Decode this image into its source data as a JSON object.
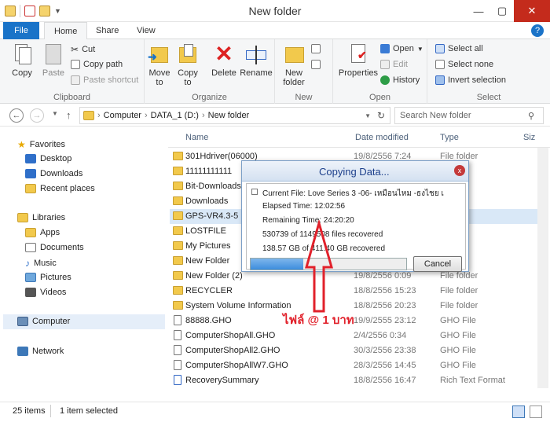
{
  "window": {
    "title": "New folder",
    "minimize": "—",
    "maximize": "▢",
    "close": "✕"
  },
  "tabs": {
    "file": "File",
    "home": "Home",
    "share": "Share",
    "view": "View",
    "help": "?"
  },
  "ribbon": {
    "clipboard": {
      "label": "Clipboard",
      "copy": "Copy",
      "paste": "Paste",
      "cut": "Cut",
      "copy_path": "Copy path",
      "paste_shortcut": "Paste shortcut"
    },
    "organize": {
      "label": "Organize",
      "move_to": "Move to",
      "copy_to": "Copy to",
      "delete": "Delete",
      "rename": "Rename"
    },
    "new": {
      "label": "New",
      "new_folder": "New folder"
    },
    "open": {
      "label": "Open",
      "properties": "Properties",
      "open": "Open",
      "edit": "Edit",
      "history": "History"
    },
    "select": {
      "label": "Select",
      "select_all": "Select all",
      "select_none": "Select none",
      "invert_selection": "Invert selection"
    }
  },
  "address": {
    "back": "←",
    "forward": "→",
    "up": "↑",
    "crumbs": [
      "Computer",
      "DATA_1 (D:)",
      "New folder"
    ],
    "refresh": "↻",
    "search_placeholder": "Search New folder"
  },
  "nav": {
    "favorites": "Favorites",
    "fav_items": [
      "Desktop",
      "Downloads",
      "Recent places"
    ],
    "libraries": "Libraries",
    "lib_items": [
      "Apps",
      "Documents",
      "Music",
      "Pictures",
      "Videos"
    ],
    "computer": "Computer",
    "network": "Network"
  },
  "columns": {
    "name": "Name",
    "date": "Date modified",
    "type": "Type",
    "size": "Siz"
  },
  "files": [
    {
      "name": "301Hdriver(06000)",
      "date": "19/8/2556 7:24",
      "type": "File folder",
      "kind": "folder"
    },
    {
      "name": "11111111111",
      "date": "",
      "type": "der",
      "kind": "folder"
    },
    {
      "name": "Bit-Downloads",
      "date": "",
      "type": "der",
      "kind": "folder"
    },
    {
      "name": "Downloads",
      "date": "",
      "type": "der",
      "kind": "folder"
    },
    {
      "name": "GPS-VR4.3-5",
      "date": "",
      "type": "der",
      "kind": "folder"
    },
    {
      "name": "LOSTFILE",
      "date": "",
      "type": "der",
      "kind": "folder"
    },
    {
      "name": "My Pictures",
      "date": "",
      "type": "der",
      "kind": "folder"
    },
    {
      "name": "New Folder",
      "date": "",
      "type": "der",
      "kind": "folder"
    },
    {
      "name": "New Folder (2)",
      "date": "19/8/2556 0:09",
      "type": "File folder",
      "kind": "folder"
    },
    {
      "name": "RECYCLER",
      "date": "18/8/2556 15:23",
      "type": "File folder",
      "kind": "folder"
    },
    {
      "name": "System Volume Information",
      "date": "18/8/2556 20:23",
      "type": "File folder",
      "kind": "folder"
    },
    {
      "name": "88888.GHO",
      "date": "19/9/2555 23:12",
      "type": "GHO File",
      "kind": "doc"
    },
    {
      "name": "ComputerShopAll.GHO",
      "date": "2/4/2556 0:34",
      "type": "GHO File",
      "kind": "doc"
    },
    {
      "name": "ComputerShopAll2.GHO",
      "date": "30/3/2556 23:38",
      "type": "GHO File",
      "kind": "doc"
    },
    {
      "name": "ComputerShopAllW7.GHO",
      "date": "28/3/2556 14:45",
      "type": "GHO File",
      "kind": "doc"
    },
    {
      "name": "RecoverySummary",
      "date": "18/8/2556 16:47",
      "type": "Rich Text Format",
      "kind": "rtf"
    }
  ],
  "status": {
    "items": "25 items",
    "selected": "1 item selected"
  },
  "dialog": {
    "title": "Copying Data...",
    "close": "x",
    "current_file": "Current File: Love Series 3 -06- เหมือนไหม -ธงไชย เ",
    "elapsed": "Elapsed Time: 12:02:56",
    "remaining": "Remaining Time: 24:20:20",
    "files_recovered": "530739 of 1149508 files recovered",
    "gb_recovered": "138.57 GB of 411.40 GB recovered",
    "progress": 0.34,
    "cancel": "Cancel"
  },
  "watermark": {
    "text": "ไฟล์ @ 1 บาท",
    "color": "#e1212b"
  }
}
